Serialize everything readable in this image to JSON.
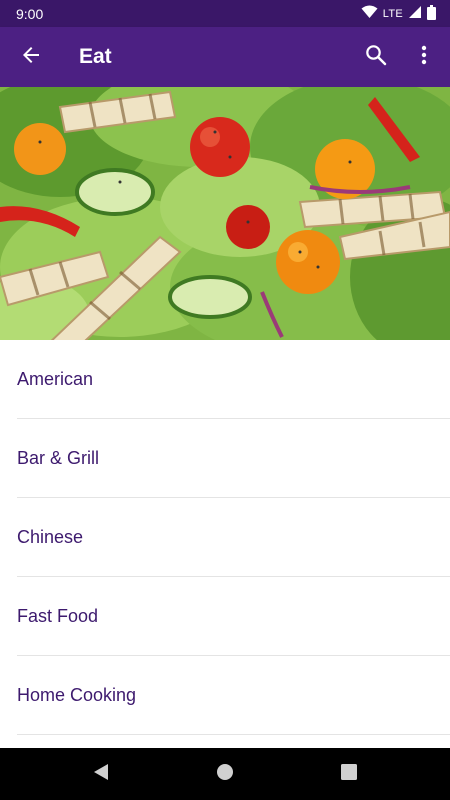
{
  "status_bar": {
    "time": "9:00",
    "network": "LTE"
  },
  "app_bar": {
    "title": "Eat"
  },
  "hero": {
    "image_alt": "Salad"
  },
  "categories": [
    {
      "label": "American"
    },
    {
      "label": "Bar & Grill"
    },
    {
      "label": "Chinese"
    },
    {
      "label": "Fast Food"
    },
    {
      "label": "Home Cooking"
    }
  ],
  "colors": {
    "status_bar": "#3a1768",
    "app_bar": "#4c2083",
    "list_text": "#3d1a6e",
    "divider": "#e4e4e4"
  },
  "icons": [
    "wifi-icon",
    "signal-icon",
    "battery-icon",
    "back-arrow-icon",
    "search-icon",
    "more-vert-icon",
    "nav-back-icon",
    "nav-home-icon",
    "nav-recents-icon"
  ]
}
